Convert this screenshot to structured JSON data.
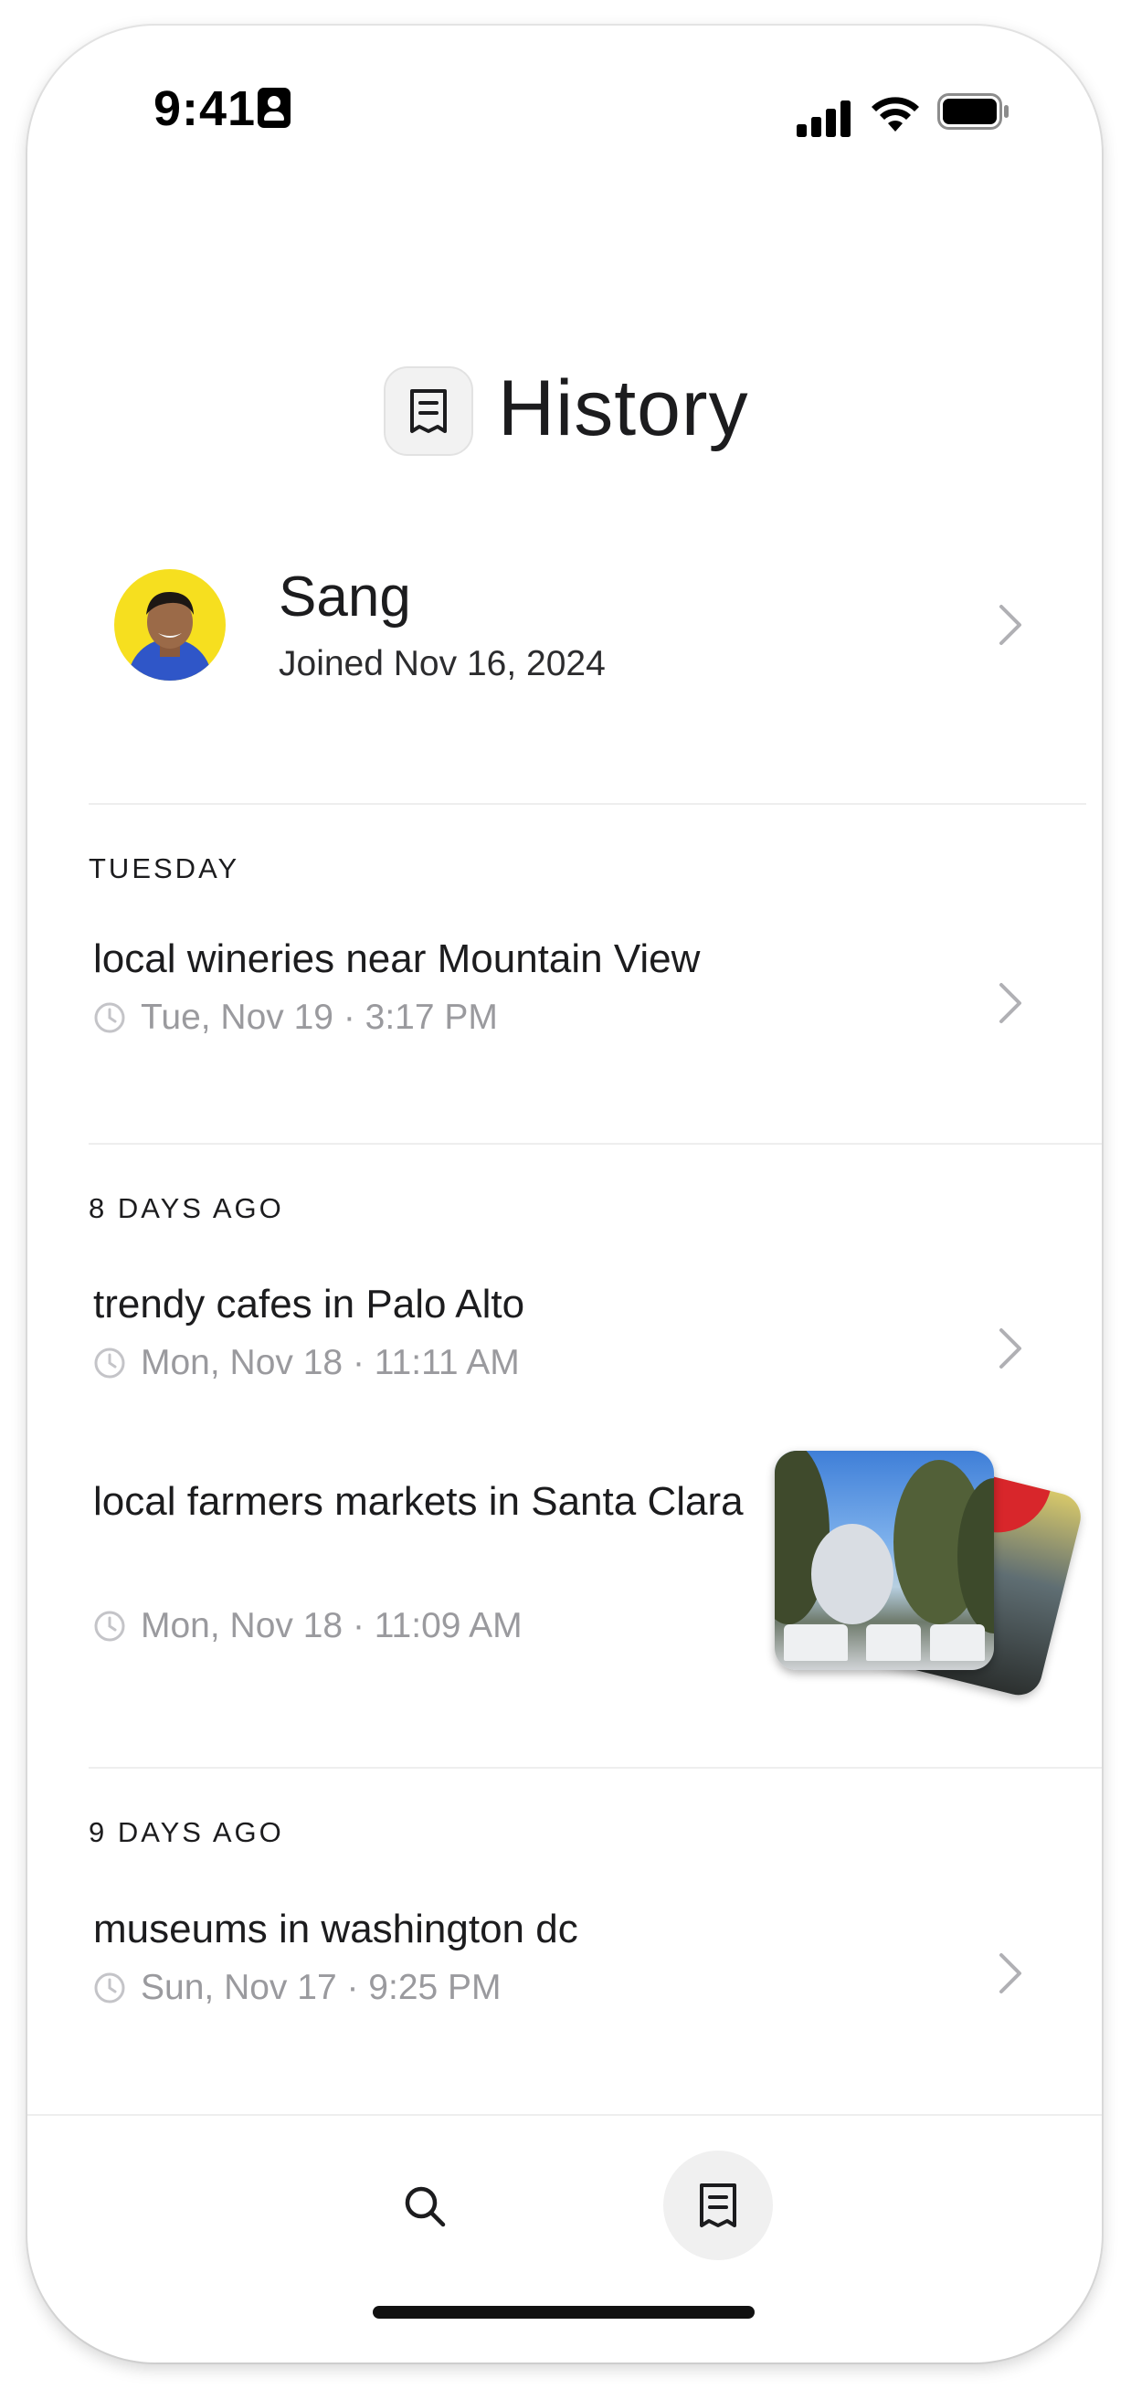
{
  "status_bar": {
    "time": "9:41",
    "icons": [
      "contact-card-icon",
      "signal-icon",
      "wifi-icon",
      "battery-icon"
    ]
  },
  "header": {
    "title": "History",
    "icon": "receipt-icon"
  },
  "profile": {
    "name": "Sang",
    "joined": "Joined Nov 16, 2024",
    "avatar_bg": "#f6df1f"
  },
  "sections": [
    {
      "label": "TUESDAY",
      "items": [
        {
          "title": "local wineries near Mountain View",
          "meta": "Tue, Nov 19 · 3:17 PM"
        }
      ]
    },
    {
      "label": "8 DAYS AGO",
      "items": [
        {
          "title": "trendy cafes in Palo Alto",
          "meta": "Mon, Nov 18 · 11:11 AM"
        },
        {
          "title": "local farmers markets in Santa Clara",
          "meta": "Mon, Nov 18 · 11:09 AM"
        }
      ]
    },
    {
      "label": "9 DAYS AGO",
      "items": [
        {
          "title": "museums in washington dc",
          "meta": "Sun, Nov 17 · 9:25 PM"
        }
      ]
    }
  ],
  "bottom_nav": {
    "items": [
      "search-icon",
      "receipt-icon"
    ],
    "active": "receipt-icon"
  },
  "colors": {
    "text": "#1c1c1e",
    "meta": "#9a9a9e",
    "chevron": "#b0b0b4",
    "divider": "#eeeeee",
    "active_nav_bg": "#f0f0f0"
  }
}
